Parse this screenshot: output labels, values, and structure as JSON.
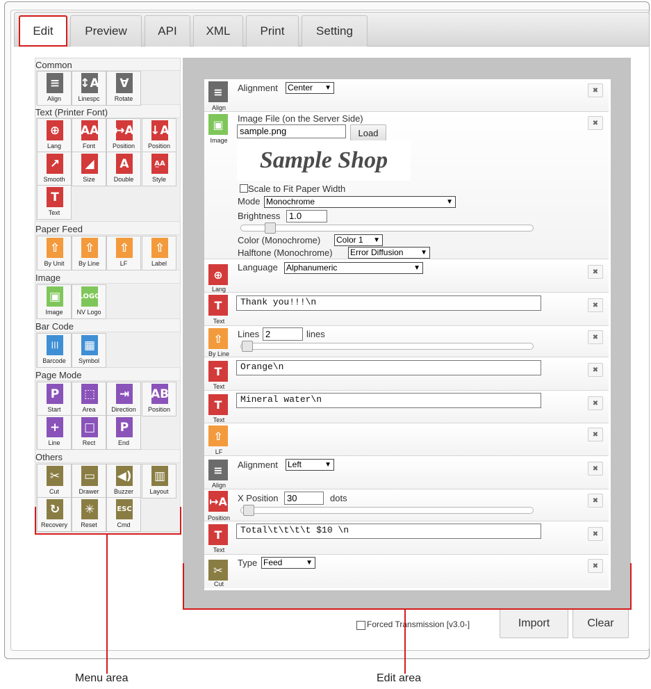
{
  "tabs": [
    "Edit",
    "Preview",
    "API",
    "XML",
    "Print",
    "Setting"
  ],
  "menu": {
    "common": {
      "title": "Common",
      "items": [
        {
          "label": "Align",
          "glyph": "≡",
          "color": "#6b6b6b"
        },
        {
          "label": "Linespc",
          "glyph": "↕A",
          "color": "#6b6b6b"
        },
        {
          "label": "Rotate",
          "glyph": "∀",
          "color": "#6b6b6b"
        }
      ]
    },
    "text": {
      "title": "Text (Printer Font)",
      "items": [
        {
          "label": "Lang",
          "glyph": "⊕",
          "color": "#d33a3a"
        },
        {
          "label": "Font",
          "glyph": "AA",
          "color": "#d33a3a"
        },
        {
          "label": "Position",
          "glyph": "↦A",
          "color": "#d33a3a"
        },
        {
          "label": "Position",
          "glyph": "↓A",
          "color": "#d33a3a"
        },
        {
          "label": "Smooth",
          "glyph": "↗",
          "color": "#d33a3a"
        },
        {
          "label": "Size",
          "glyph": "◢",
          "color": "#d33a3a"
        },
        {
          "label": "Double",
          "glyph": "A",
          "color": "#d33a3a"
        },
        {
          "label": "Style",
          "glyph": "A̲A",
          "color": "#d33a3a"
        },
        {
          "label": "Text",
          "glyph": "T",
          "color": "#d33a3a"
        }
      ]
    },
    "feed": {
      "title": "Paper Feed",
      "items": [
        {
          "label": "By Unit",
          "glyph": "⇧",
          "color": "#f39a3c"
        },
        {
          "label": "By Line",
          "glyph": "⇧",
          "color": "#f39a3c"
        },
        {
          "label": "LF",
          "glyph": "⇧",
          "color": "#f39a3c"
        },
        {
          "label": "Label",
          "glyph": "⇧",
          "color": "#f39a3c"
        }
      ]
    },
    "image": {
      "title": "Image",
      "items": [
        {
          "label": "Image",
          "glyph": "▣",
          "color": "#7fc65a"
        },
        {
          "label": "NV Logo",
          "glyph": "LOGO",
          "color": "#7fc65a"
        }
      ]
    },
    "barcode": {
      "title": "Bar Code",
      "items": [
        {
          "label": "Barcode",
          "glyph": "|||",
          "color": "#3f8fd5"
        },
        {
          "label": "Symbol",
          "glyph": "▦",
          "color": "#3f8fd5"
        }
      ]
    },
    "page": {
      "title": "Page Mode",
      "items": [
        {
          "label": "Start",
          "glyph": "P",
          "color": "#8a53b9"
        },
        {
          "label": "Area",
          "glyph": "⬚",
          "color": "#8a53b9"
        },
        {
          "label": "Direction",
          "glyph": "⇥",
          "color": "#8a53b9"
        },
        {
          "label": "Position",
          "glyph": "AB",
          "color": "#8a53b9"
        },
        {
          "label": "Line",
          "glyph": "+",
          "color": "#8a53b9"
        },
        {
          "label": "Rect",
          "glyph": "□",
          "color": "#8a53b9"
        },
        {
          "label": "End",
          "glyph": "P",
          "color": "#8a53b9"
        }
      ]
    },
    "others": {
      "title": "Others",
      "items": [
        {
          "label": "Cut",
          "glyph": "✂",
          "color": "#8a7d44"
        },
        {
          "label": "Drawer",
          "glyph": "▭",
          "color": "#8a7d44"
        },
        {
          "label": "Buzzer",
          "glyph": "◀)",
          "color": "#8a7d44"
        },
        {
          "label": "Layout",
          "glyph": "▥",
          "color": "#8a7d44"
        },
        {
          "label": "Recovery",
          "glyph": "↻",
          "color": "#8a7d44"
        },
        {
          "label": "Reset",
          "glyph": "✳",
          "color": "#8a7d44"
        },
        {
          "label": "Cmd",
          "glyph": "ESC",
          "color": "#8a7d44"
        }
      ]
    }
  },
  "edit": {
    "align1": {
      "label": "Align",
      "field": "Alignment",
      "value": "Center"
    },
    "image": {
      "label": "Image",
      "file_label": "Image File (on the Server Side)",
      "file_value": "sample.png",
      "load": "Load",
      "preview_text": "Sample Shop",
      "scale_label": "Scale to Fit Paper Width",
      "mode_label": "Mode",
      "mode_value": "Monochrome",
      "brightness_label": "Brightness",
      "brightness_value": "1.0",
      "color_label": "Color (Monochrome)",
      "color_value": "Color 1",
      "halftone_label": "Halftone (Monochrome)",
      "halftone_value": "Error Diffusion"
    },
    "lang": {
      "label": "Lang",
      "field": "Language",
      "value": "Alphanumeric"
    },
    "text1": {
      "label": "Text",
      "value": "Thank you!!!\\n"
    },
    "byline": {
      "label": "By Line",
      "field": "Lines",
      "value": "2",
      "unit": "lines"
    },
    "text2": {
      "label": "Text",
      "value": "Orange\\n"
    },
    "text3": {
      "label": "Text",
      "value": "Mineral water\\n"
    },
    "lf": {
      "label": "LF"
    },
    "align2": {
      "label": "Align",
      "field": "Alignment",
      "value": "Left"
    },
    "position": {
      "label": "Position",
      "field": "X Position",
      "value": "30",
      "unit": "dots"
    },
    "text4": {
      "label": "Text",
      "value": "Total\\t\\t\\t\\t $10 \\n"
    },
    "cut": {
      "label": "Cut",
      "field": "Type",
      "value": "Feed"
    }
  },
  "footer": {
    "forced": "Forced Transmission [v3.0-]",
    "import": "Import",
    "clear": "Clear"
  },
  "callouts": {
    "menu": "Menu area",
    "edit": "Edit area"
  }
}
